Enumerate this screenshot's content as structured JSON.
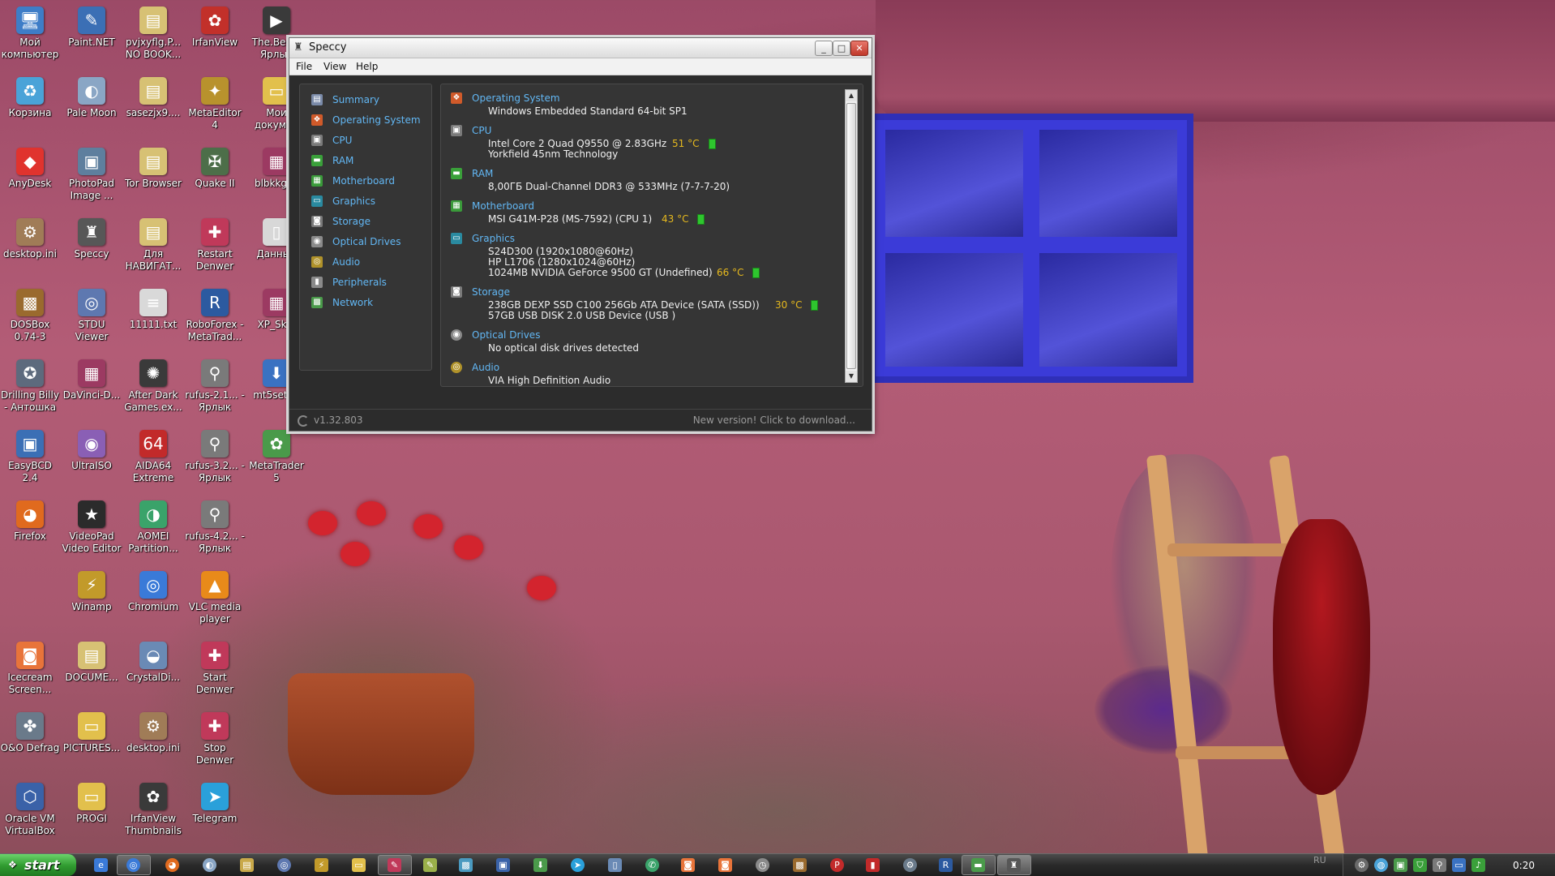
{
  "desktop": {
    "icons": [
      {
        "label": "Мой компьютер",
        "glyph": "🖥",
        "color": "#3e7dc7"
      },
      {
        "label": "Paint.NET",
        "glyph": "✎",
        "color": "#3b6fb5"
      },
      {
        "label": "pvjxyflg.P... NO BOOK...",
        "glyph": "▤",
        "color": "#d7c174"
      },
      {
        "label": "IrfanView",
        "glyph": "✿",
        "color": "#c2302a"
      },
      {
        "label": "The.Beel - Ярлык",
        "glyph": "▶",
        "color": "#3a3a3a"
      },
      {
        "label": "Корзина",
        "glyph": "♻",
        "color": "#4aa3d8"
      },
      {
        "label": "Pale Moon",
        "glyph": "◐",
        "color": "#8aa6c5"
      },
      {
        "label": "sasezjx9....",
        "glyph": "▤",
        "color": "#d7c174"
      },
      {
        "label": "MetaEditor 4",
        "glyph": "✦",
        "color": "#b8922d"
      },
      {
        "label": "Мои докумен",
        "glyph": "▭",
        "color": "#e2c04c"
      },
      {
        "label": "AnyDesk",
        "glyph": "◆",
        "color": "#e0332e"
      },
      {
        "label": "PhotoPad Image ...",
        "glyph": "▣",
        "color": "#5e7f9e"
      },
      {
        "label": "Tor Browser",
        "glyph": "▤",
        "color": "#d7c174"
      },
      {
        "label": "Quake II",
        "glyph": "✠",
        "color": "#4d6e49"
      },
      {
        "label": "blbkkgca",
        "glyph": "▦",
        "color": "#9c3a62"
      },
      {
        "label": "desktop.ini",
        "glyph": "⚙",
        "color": "#a07c57"
      },
      {
        "label": "Speccy",
        "glyph": "♜",
        "color": "#575757"
      },
      {
        "label": "Для НАВИГАТ...",
        "glyph": "▤",
        "color": "#d7c174"
      },
      {
        "label": "Restart Denwer",
        "glyph": "✚",
        "color": "#c0395a"
      },
      {
        "label": "Данные",
        "glyph": "▯",
        "color": "#d8d8d8"
      },
      {
        "label": "DOSBox 0.74-3",
        "glyph": "▩",
        "color": "#9a6a2e"
      },
      {
        "label": "STDU Viewer",
        "glyph": "◎",
        "color": "#5e78b0"
      },
      {
        "label": "11111.txt",
        "glyph": "≡",
        "color": "#d9d9d9"
      },
      {
        "label": "RoboForex - MetaTrad...",
        "glyph": "R",
        "color": "#2c5aa0"
      },
      {
        "label": "XP_Skin",
        "glyph": "▦",
        "color": "#9c3a62"
      },
      {
        "label": "Drilling Billy - Антошка",
        "glyph": "✪",
        "color": "#5d6a7d"
      },
      {
        "label": "DaVinci-D...",
        "glyph": "▦",
        "color": "#9c3a62"
      },
      {
        "label": "After Dark Games.ex...",
        "glyph": "✺",
        "color": "#3a3a3a"
      },
      {
        "label": "rufus-2.1... - Ярлык",
        "glyph": "⚲",
        "color": "#7a7a7a"
      },
      {
        "label": "mt5setup",
        "glyph": "⬇",
        "color": "#3a72c2"
      },
      {
        "label": "EasyBCD 2.4",
        "glyph": "▣",
        "color": "#3b6fb5"
      },
      {
        "label": "UltraISO",
        "glyph": "◉",
        "color": "#8a5fb5"
      },
      {
        "label": "AIDA64 Extreme",
        "glyph": "64",
        "color": "#c22a2a"
      },
      {
        "label": "rufus-3.2... - Ярлык",
        "glyph": "⚲",
        "color": "#7a7a7a"
      },
      {
        "label": "MetaTrader 5",
        "glyph": "✿",
        "color": "#4a9a4a"
      },
      {
        "label": "Firefox",
        "glyph": "◕",
        "color": "#e06a1e"
      },
      {
        "label": "VideoPad Video Editor",
        "glyph": "★",
        "color": "#2b2b2b"
      },
      {
        "label": "AOMEI Partition...",
        "glyph": "◑",
        "color": "#3aa36a"
      },
      {
        "label": "rufus-4.2... - Ярлык",
        "glyph": "⚲",
        "color": "#7a7a7a"
      },
      {
        "label": "Winamp",
        "glyph": "⚡",
        "color": "#c29a2a"
      },
      {
        "label": "Chromium",
        "glyph": "◎",
        "color": "#3a7ad8"
      },
      {
        "label": "VLC media player",
        "glyph": "▲",
        "color": "#e88a1a"
      },
      {
        "label": "Icecream Screen...",
        "glyph": "◙",
        "color": "#e8743a"
      },
      {
        "label": "DOCUME...",
        "glyph": "▤",
        "color": "#d7c174"
      },
      {
        "label": "CrystalDi...",
        "glyph": "◒",
        "color": "#6a8ab5"
      },
      {
        "label": "Start Denwer",
        "glyph": "✚",
        "color": "#c0395a"
      },
      {
        "label": "O&O Defrag",
        "glyph": "✤",
        "color": "#6a7a8a"
      },
      {
        "label": "PICTURES...",
        "glyph": "▭",
        "color": "#e2c04c"
      },
      {
        "label": "desktop.ini",
        "glyph": "⚙",
        "color": "#a07c57"
      },
      {
        "label": "Stop Denwer",
        "glyph": "✚",
        "color": "#c0395a"
      },
      {
        "label": "Oracle VM VirtualBox",
        "glyph": "⬡",
        "color": "#3a62a8"
      },
      {
        "label": "PROGI",
        "glyph": "▭",
        "color": "#e2c04c"
      },
      {
        "label": "IrfanView Thumbnails",
        "glyph": "✿",
        "color": "#3a3a3a"
      },
      {
        "label": "Telegram",
        "glyph": "➤",
        "color": "#2aa0da"
      }
    ]
  },
  "speccy": {
    "title": "Speccy",
    "menu": [
      "File",
      "View",
      "Help"
    ],
    "sidebar": [
      {
        "label": "Summary",
        "glyph": "▤",
        "color": "#7a8aa8"
      },
      {
        "label": "Operating System",
        "glyph": "❖",
        "color": "#d05a2a"
      },
      {
        "label": "CPU",
        "glyph": "▣",
        "color": "#7a7a7a"
      },
      {
        "label": "RAM",
        "glyph": "▬",
        "color": "#3aa03a"
      },
      {
        "label": "Motherboard",
        "glyph": "▦",
        "color": "#3a9a3a"
      },
      {
        "label": "Graphics",
        "glyph": "▭",
        "color": "#2a8aa0"
      },
      {
        "label": "Storage",
        "glyph": "◙",
        "color": "#7a7a7a"
      },
      {
        "label": "Optical Drives",
        "glyph": "◉",
        "color": "#8a8a8a"
      },
      {
        "label": "Audio",
        "glyph": "◎",
        "color": "#b0922a"
      },
      {
        "label": "Peripherals",
        "glyph": "▮",
        "color": "#8a8a8a"
      },
      {
        "label": "Network",
        "glyph": "▩",
        "color": "#4a9a4a"
      }
    ],
    "sections": {
      "os": {
        "title": "Operating System",
        "lines": [
          "Windows Embedded Standard 64-bit SP1"
        ]
      },
      "cpu": {
        "title": "CPU",
        "lines": [
          "Intel Core 2 Quad Q9550 @ 2.83GHz",
          "Yorkfield 45nm Technology"
        ],
        "temp": "51 °C"
      },
      "ram": {
        "title": "RAM",
        "lines": [
          "8,00ГБ Dual-Channel DDR3 @ 533MHz (7-7-7-20)"
        ]
      },
      "motherboard": {
        "title": "Motherboard",
        "lines": [
          "MSI G41M-P28 (MS-7592) (CPU 1)"
        ],
        "temp": "43 °C"
      },
      "graphics": {
        "title": "Graphics",
        "lines": [
          "S24D300 (1920x1080@60Hz)",
          "HP L1706 (1280x1024@60Hz)",
          "1024MB NVIDIA GeForce 9500 GT (Undefined)"
        ],
        "temp": "66 °C"
      },
      "storage": {
        "title": "Storage",
        "lines": [
          "238GB DEXP SSD C100 256Gb ATA Device (SATA (SSD))",
          "57GB USB DISK 2.0 USB Device (USB )"
        ],
        "temp": "30 °C"
      },
      "optical": {
        "title": "Optical Drives",
        "lines": [
          "No optical disk drives detected"
        ]
      },
      "audio": {
        "title": "Audio",
        "lines": [
          "VIA High Definition Audio"
        ]
      }
    },
    "status": {
      "version": "v1.32.803",
      "new_version": "New version! Click to download..."
    }
  },
  "taskbar": {
    "start_label": "start",
    "lang": "RU",
    "clock": "0:20"
  }
}
